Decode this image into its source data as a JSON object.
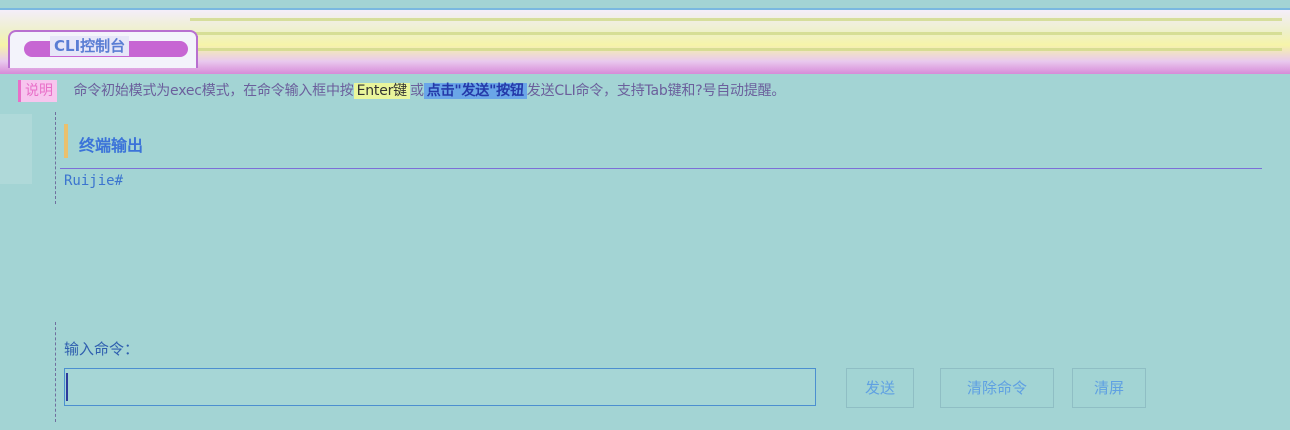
{
  "window": {
    "title": "CLI控制台"
  },
  "help": {
    "label": "说明",
    "text_before": "命令初始模式为exec模式，在命令输入框中按",
    "enter_key": "Enter键",
    "or": "或",
    "send_click": "点击\"发送\"按钮",
    "text_after": "发送CLI命令，支持Tab键和?号自动提醒。"
  },
  "output": {
    "title": "终端输出",
    "content": "Ruijie#"
  },
  "command": {
    "label": "输入命令：",
    "value": "",
    "placeholder": ""
  },
  "buttons": {
    "send": "发送",
    "clear_command": "清除命令",
    "clear_screen": "清屏"
  },
  "colors": {
    "background": "#a3d4d4",
    "accent": "#c766d3",
    "link": "#3b73d9"
  }
}
